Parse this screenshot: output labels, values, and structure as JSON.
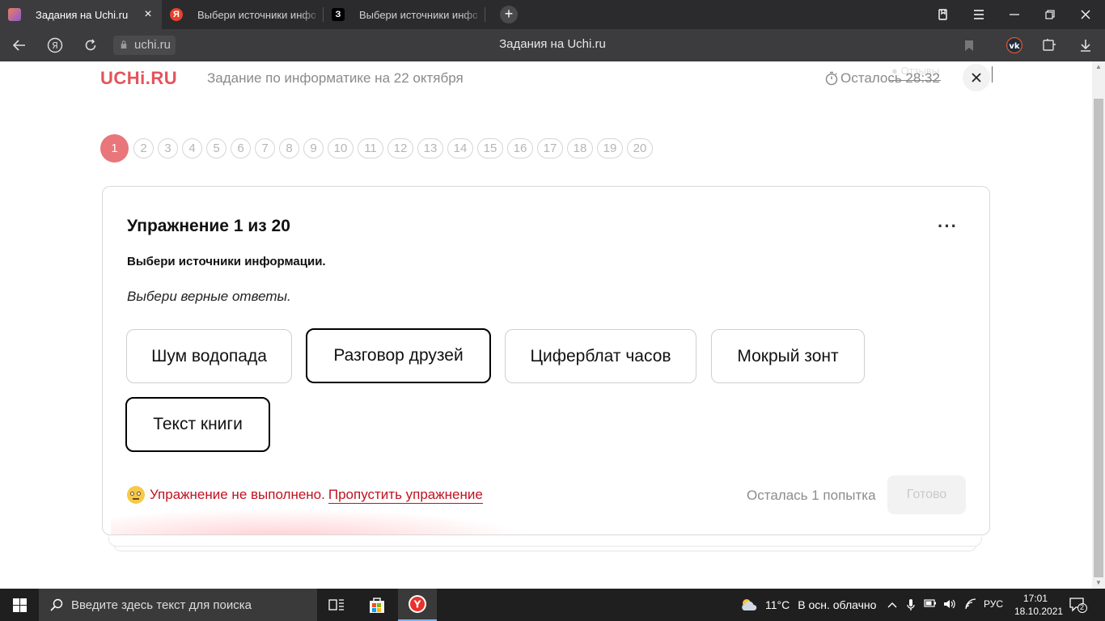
{
  "browser": {
    "tabs": [
      {
        "title": "Задания на Uchi.ru",
        "active": true,
        "favicon": "uchi-favicon"
      },
      {
        "title": "Выбери источники инфор",
        "active": false,
        "favicon": "yandex-favicon",
        "favicon_letter": "Я"
      },
      {
        "title": "Выбери источники инфор",
        "active": false,
        "favicon": "znanija-favicon",
        "favicon_letter": "З"
      }
    ],
    "address": "uchi.ru",
    "page_title": "Задания на Uchi.ru",
    "feedback_label": "Отзывы"
  },
  "header": {
    "logo": "UCHi.RU",
    "task_title": "Задание по информатике на 22 октября",
    "timer": "Осталось 28:32"
  },
  "pager": {
    "current": 1,
    "pages": [
      "1",
      "2",
      "3",
      "4",
      "5",
      "6",
      "7",
      "8",
      "9",
      "10",
      "11",
      "12",
      "13",
      "14",
      "15",
      "16",
      "17",
      "18",
      "19",
      "20"
    ]
  },
  "exercise": {
    "title": "Упражнение 1 из 20",
    "menu": "···",
    "question": "Выбери источники информации.",
    "hint": "Выбери верные ответы.",
    "options": [
      {
        "label": "Шум водопада",
        "selected": false
      },
      {
        "label": "Разговор друзей",
        "selected": true
      },
      {
        "label": "Циферблат часов",
        "selected": false
      },
      {
        "label": "Мокрый зонт",
        "selected": false
      },
      {
        "label": "Текст книги",
        "selected": true
      }
    ],
    "status": "Упражнение не выполнено.",
    "skip_label": "Пропустить упражнение",
    "attempts": "Осталась 1 попытка",
    "done_label": "Готово"
  },
  "taskbar": {
    "search_placeholder": "Введите здесь текст для поиска",
    "weather_temp": "11°C",
    "weather_text": "В осн. облачно",
    "language": "РУС",
    "time": "17:01",
    "date": "18.10.2021",
    "notifications": "2"
  },
  "colors": {
    "brand": "#e3545b",
    "error": "#c0121f",
    "current_page": "#e8767a"
  }
}
